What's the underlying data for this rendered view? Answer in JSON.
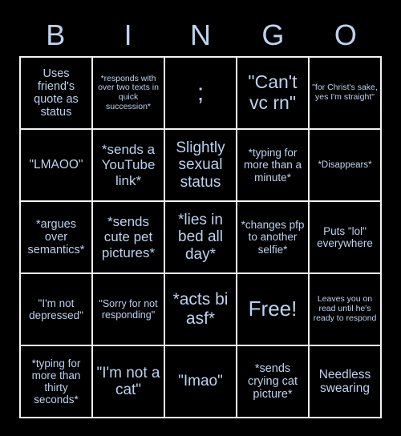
{
  "title": {
    "letters": [
      "B",
      "I",
      "N",
      "G",
      "O"
    ]
  },
  "colors": {
    "background": "#000000",
    "text": "#bcd2ee",
    "grid_line": "#f2f2f2"
  },
  "grid": {
    "rows": [
      [
        {
          "text": "Uses friend's quote as status",
          "size": "fs-14"
        },
        {
          "text": "*responds with over two texts in quick succession*",
          "size": "fs-10"
        },
        {
          "text": ";",
          "size": "fs-30"
        },
        {
          "text": "\"Can't vc rn\"",
          "size": "fs-23"
        },
        {
          "text": "\"for Christ's sake, yes I'm straight\"",
          "size": "fs-10"
        }
      ],
      [
        {
          "text": "\"LMAOO\"",
          "size": "fs-15"
        },
        {
          "text": "*sends a YouTube link*",
          "size": "fs-17"
        },
        {
          "text": "Slightly sexual status",
          "size": "fs-19"
        },
        {
          "text": "*typing for more than a minute*",
          "size": "fs-13"
        },
        {
          "text": "*Disappears*",
          "size": "fs-11"
        }
      ],
      [
        {
          "text": "*argues over semantics*",
          "size": "fs-14"
        },
        {
          "text": "*sends cute pet pictures*",
          "size": "fs-17"
        },
        {
          "text": "*lies in bed all day*",
          "size": "fs-19"
        },
        {
          "text": "*changes pfp to another selfie*",
          "size": "fs-13"
        },
        {
          "text": "Puts \"lol\" everywhere",
          "size": "fs-13"
        }
      ],
      [
        {
          "text": "\"I'm not depressed\"",
          "size": "fs-13"
        },
        {
          "text": "\"Sorry for not responding\"",
          "size": "fs-12"
        },
        {
          "text": "*acts bi asf*",
          "size": "fs-21"
        },
        {
          "text": "Free!",
          "size": "fs-26"
        },
        {
          "text": "Leaves you on read until he's ready to respond",
          "size": "fs-10"
        }
      ],
      [
        {
          "text": "*typing for more than thirty seconds*",
          "size": "fs-13"
        },
        {
          "text": "\"I'm not a cat\"",
          "size": "fs-19"
        },
        {
          "text": "\"Imao\"",
          "size": "fs-19"
        },
        {
          "text": "*sends crying cat picture*",
          "size": "fs-14"
        },
        {
          "text": "Needless swearing",
          "size": "fs-15"
        }
      ]
    ]
  }
}
